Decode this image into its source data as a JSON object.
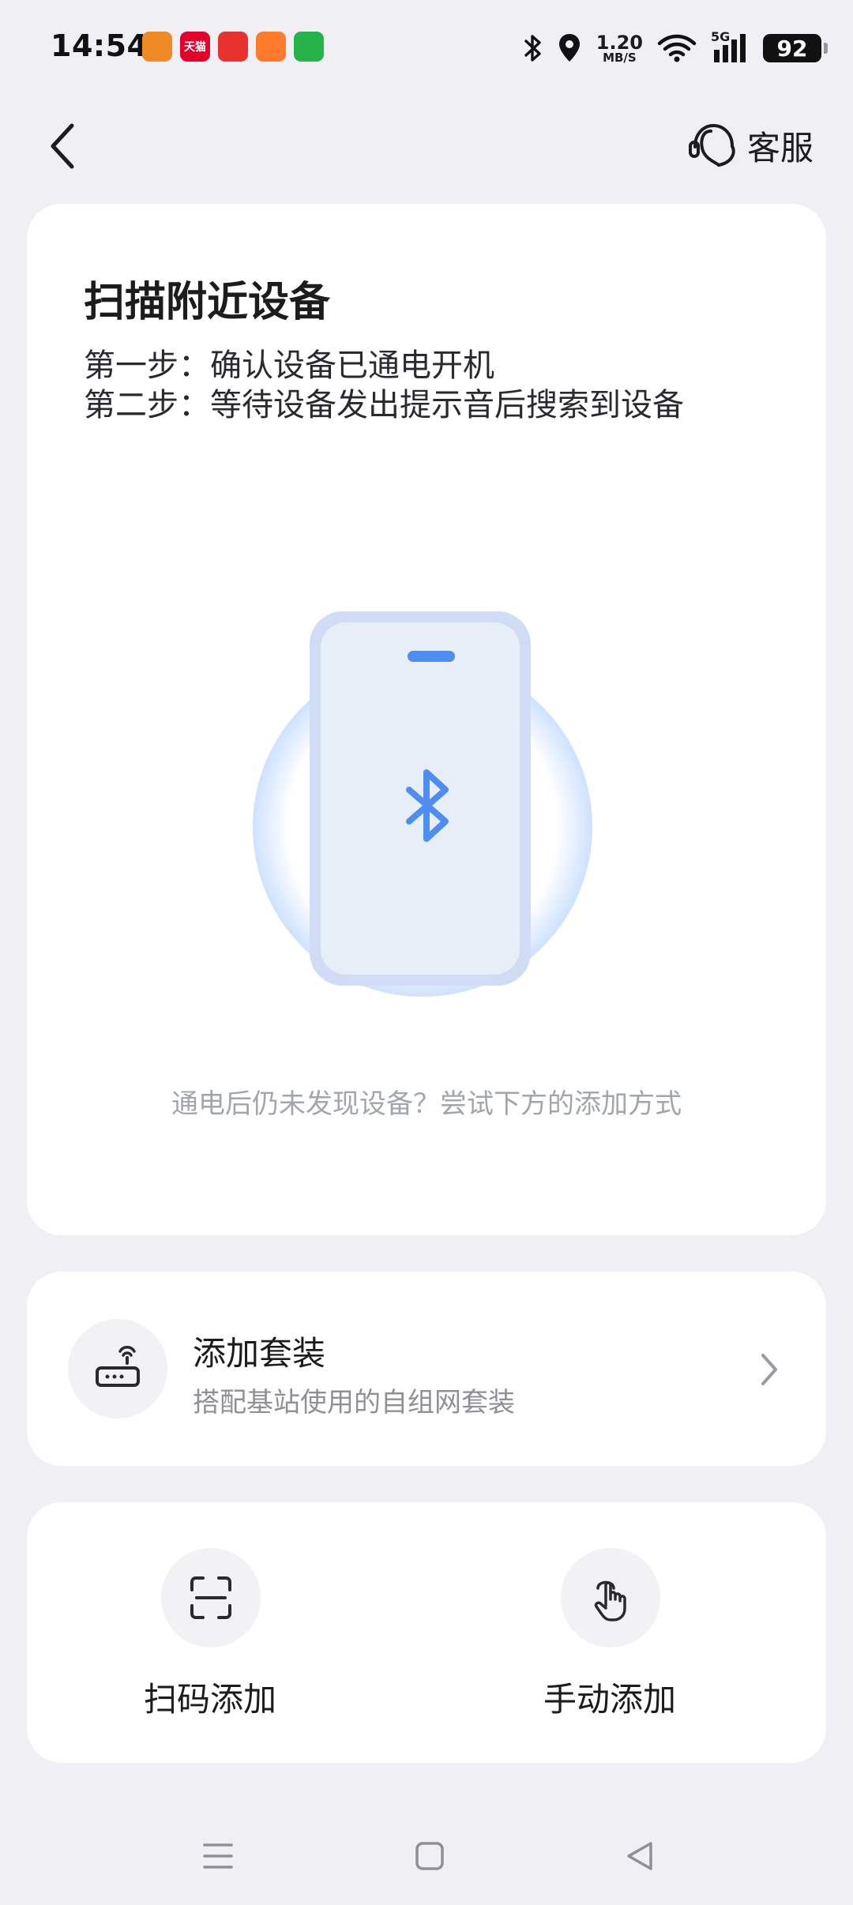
{
  "status_bar": {
    "time": "14:54",
    "app_icons": [
      {
        "name": "app-icon-orange",
        "glyph": "",
        "color": "#f08a24"
      },
      {
        "name": "app-icon-tmall",
        "glyph": "天猫",
        "color": "#e4002b"
      },
      {
        "name": "app-icon-red",
        "glyph": "",
        "color": "#e8322e"
      },
      {
        "name": "app-icon-shop",
        "glyph": "",
        "color": "#ff7a2a"
      },
      {
        "name": "app-icon-green",
        "glyph": "",
        "color": "#26b34a"
      }
    ],
    "net_speed_value": "1.20",
    "net_speed_unit": "MB/S",
    "signal_type": "5G",
    "battery": "92"
  },
  "nav": {
    "service_label": "客服"
  },
  "scan_card": {
    "title": "扫描附近设备",
    "step1": "第一步：确认设备已通电开机",
    "step2": "第二步：等待设备发出提示音后搜索到设备",
    "hint": "通电后仍未发现设备？尝试下方的添加方式"
  },
  "kit_card": {
    "title": "添加套装",
    "subtitle": "搭配基站使用的自组网套装"
  },
  "add_options": {
    "scan_label": "扫码添加",
    "manual_label": "手动添加"
  },
  "colors": {
    "accent_blue": "#4d8ef0",
    "background": "#efeff4",
    "card": "#ffffff"
  }
}
